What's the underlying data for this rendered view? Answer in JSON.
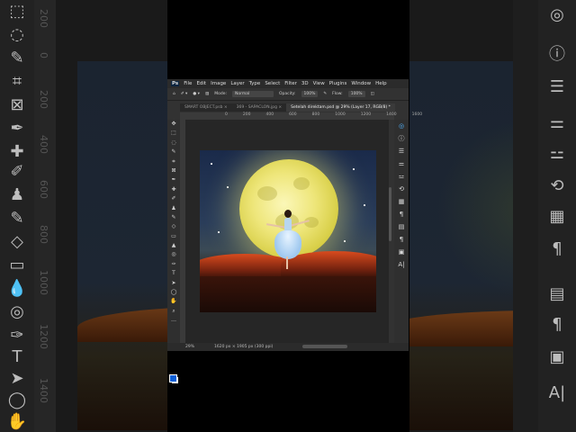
{
  "menu": {
    "logo": "Ps",
    "items": [
      "File",
      "Edit",
      "Image",
      "Layer",
      "Type",
      "Select",
      "Filter",
      "3D",
      "View",
      "Plugins",
      "Window",
      "Help"
    ]
  },
  "options": {
    "mode_label": "Mode:",
    "mode_value": "Normal",
    "opacity_label": "Opacity:",
    "opacity_value": "100%",
    "flow_label": "Flow:",
    "flow_value": "100%"
  },
  "tabs": [
    {
      "label": "SMART OBJECT.psb ×",
      "active": false
    },
    {
      "label": "369 - SAPACLON.jpg ×",
      "active": false
    },
    {
      "label": "Setelah direktam.psd @ 29% (Layer 17, RGB/8) *",
      "active": true
    }
  ],
  "ruler_ticks": [
    "-200",
    "0",
    "200",
    "400",
    "600",
    "800",
    "1000",
    "1200",
    "1400",
    "1600"
  ],
  "status": {
    "zoom": "29%",
    "doc_info": "1620 px × 1905 px (300 ppi)"
  },
  "background_ruler_digits": [
    "200",
    "0",
    "200",
    "400",
    "600",
    "800",
    "1000",
    "1200",
    "1400"
  ],
  "colors": {
    "foreground": "#0b5fd6",
    "background": "#ffffff",
    "accent": "#4fb3ff"
  }
}
